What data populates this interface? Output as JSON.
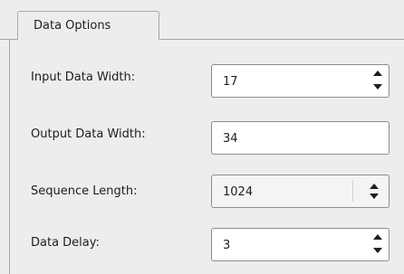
{
  "tab": {
    "label": "Data Options"
  },
  "fields": [
    {
      "label": "Input Data Width:",
      "value": "17",
      "control": "spinbox"
    },
    {
      "label": "Output Data Width:",
      "value": "34",
      "control": "text"
    },
    {
      "label": "Sequence Length:",
      "value": "1024",
      "control": "combo-spin"
    },
    {
      "label": "Data Delay:",
      "value": "3",
      "control": "spinbox"
    }
  ],
  "icons": {
    "spin_up": "triangle-up-icon",
    "spin_down": "triangle-down-icon"
  },
  "colors": {
    "background": "#ededed",
    "field_background": "#ffffff",
    "border": "#8c8c8c",
    "tab_border": "#a8a8a8"
  }
}
